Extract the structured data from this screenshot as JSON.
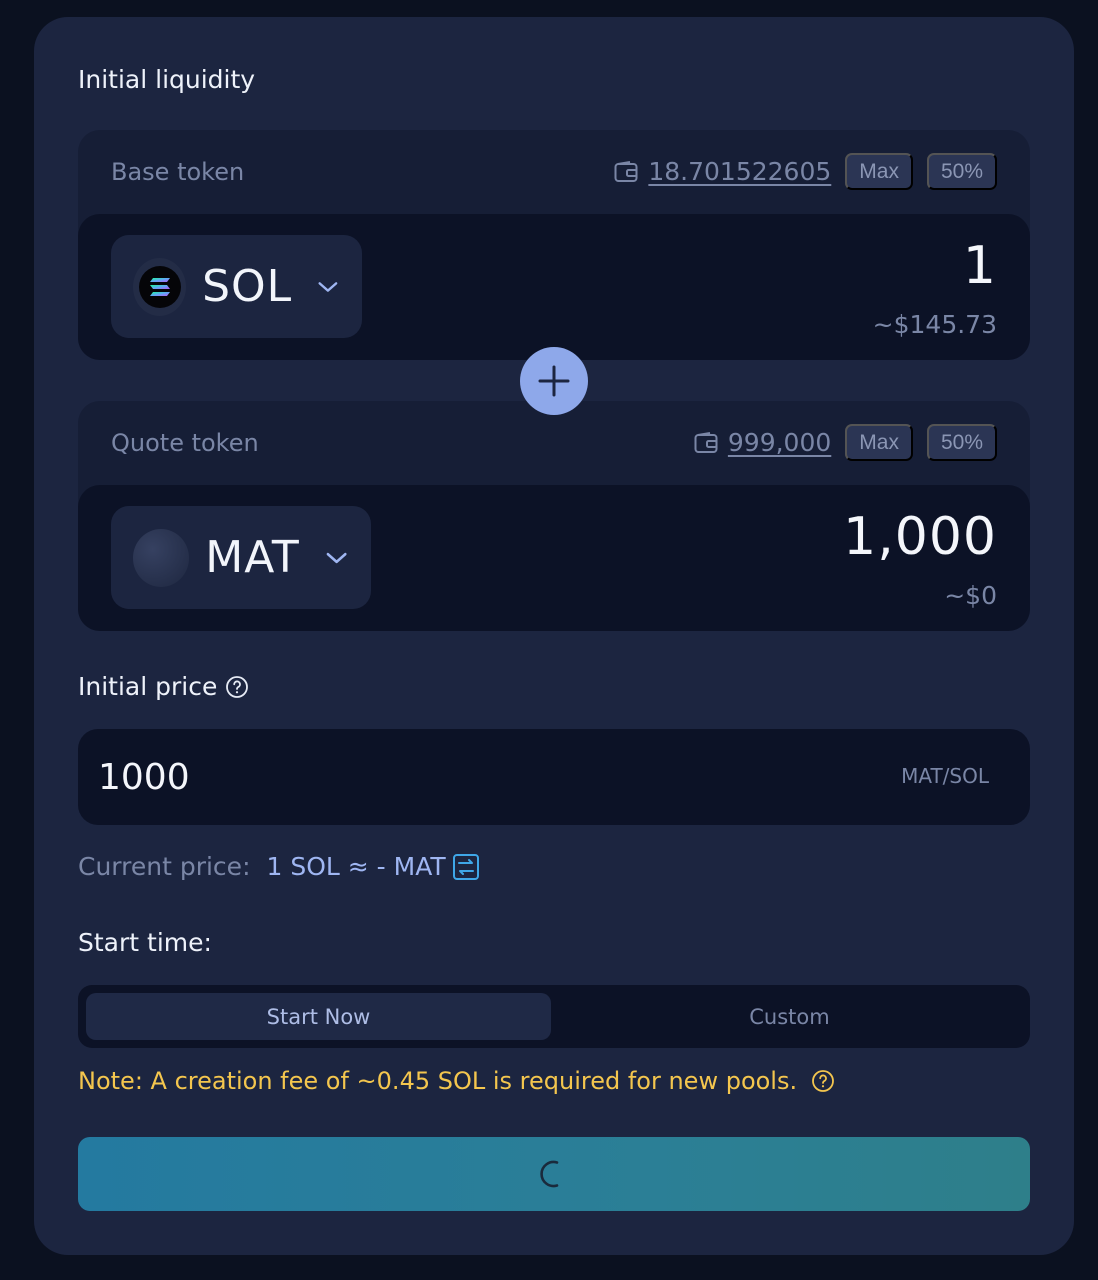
{
  "section_title": "Initial liquidity",
  "base": {
    "label": "Base token",
    "balance": "18.701522605",
    "max_label": "Max",
    "half_label": "50%",
    "symbol": "SOL",
    "amount": "1",
    "usd": "~$145.73",
    "icon": "solana-logo-icon"
  },
  "quote": {
    "label": "Quote token",
    "balance": "999,000",
    "max_label": "Max",
    "half_label": "50%",
    "symbol": "MAT",
    "amount": "1,000",
    "usd": "~$0",
    "icon": "token-placeholder-icon"
  },
  "initial_price": {
    "label": "Initial price",
    "value": "1000",
    "unit": "MAT/SOL"
  },
  "current_price": {
    "label": "Current price:",
    "value": "1 SOL ≈ - MAT"
  },
  "start_time": {
    "label": "Start time:",
    "options": [
      "Start Now",
      "Custom"
    ],
    "selected": "Start Now"
  },
  "note": "Note: A creation fee of ~0.45 SOL is required for new pools.",
  "submit": {
    "state": "loading",
    "icon": "spinner-icon"
  },
  "colors": {
    "card": "#1c2540",
    "input_bg": "#0c1226",
    "accent": "#8ea8ea",
    "note": "#f4c64e",
    "button_from": "#247aa0",
    "button_to": "#2e7f8a"
  }
}
